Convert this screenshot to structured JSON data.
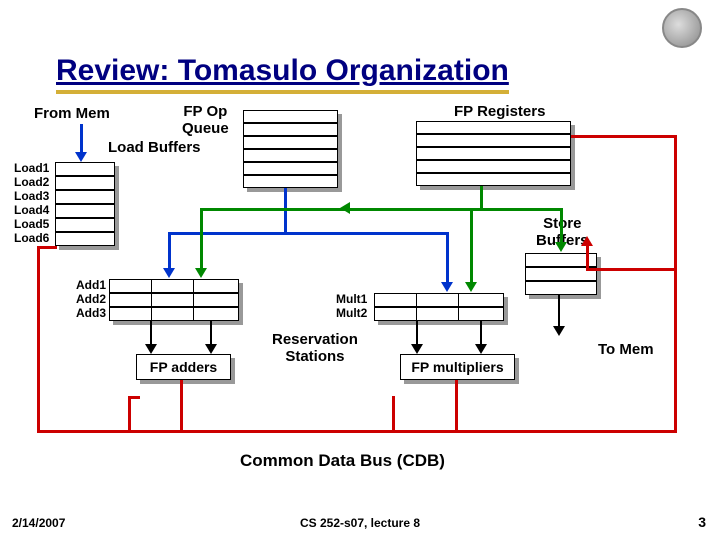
{
  "title": "Review: Tomasulo Organization",
  "labels": {
    "from_mem": "From Mem",
    "fp_op_queue_line1": "FP Op",
    "fp_op_queue_line2": "Queue",
    "load_buffers": "Load Buffers",
    "fp_registers": "FP Registers",
    "store_buffers_line1": "Store",
    "store_buffers_line2": "Buffers",
    "reservation_line1": "Reservation",
    "reservation_line2": "Stations",
    "to_mem": "To Mem",
    "fp_adders": "FP adders",
    "fp_multipliers": "FP multipliers",
    "cdb": "Common Data Bus (CDB)"
  },
  "load_rows": [
    "Load1",
    "Load2",
    "Load3",
    "Load4",
    "Load5",
    "Load6"
  ],
  "add_rows": [
    "Add1",
    "Add2",
    "Add3"
  ],
  "mult_rows": [
    "Mult1",
    "Mult2"
  ],
  "footer": {
    "date": "2/14/2007",
    "course": "CS 252-s07, lecture 8",
    "page": "3"
  }
}
